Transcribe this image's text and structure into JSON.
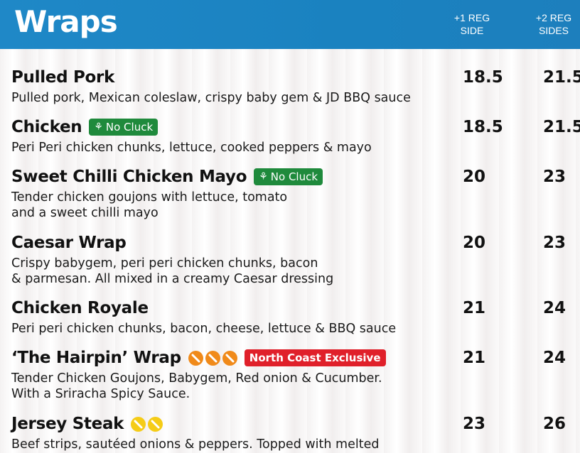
{
  "header": {
    "title": "Wraps",
    "col1": [
      "+1 REG",
      "SIDE"
    ],
    "col2": [
      "+2 REG",
      "SIDES"
    ]
  },
  "badges": {
    "no_cluck": "No Cluck",
    "north_coast": "North Coast Exclusive"
  },
  "items": [
    {
      "name": "Pulled Pork",
      "desc": [
        "Pulled pork, Mexican coleslaw, crispy baby gem & JD BBQ sauce"
      ],
      "p1": "18.5",
      "p2": "21.5"
    },
    {
      "name": "Chicken",
      "desc": [
        "Peri Peri chicken chunks, lettuce, cooked peppers & mayo"
      ],
      "p1": "18.5",
      "p2": "21.5"
    },
    {
      "name": "Sweet Chilli Chicken Mayo",
      "desc": [
        "Tender chicken goujons with lettuce, tomato",
        "and a sweet chilli mayo"
      ],
      "p1": "20",
      "p2": "23"
    },
    {
      "name": "Caesar Wrap",
      "desc": [
        "Crispy babygem, peri peri chicken chunks, bacon",
        "& parmesan. All mixed in a creamy Caesar dressing"
      ],
      "p1": "20",
      "p2": "23"
    },
    {
      "name": "Chicken Royale",
      "desc": [
        "Peri peri chicken chunks, bacon, cheese, lettuce & BBQ sauce"
      ],
      "p1": "21",
      "p2": "24"
    },
    {
      "name": "‘The Hairpin’ Wrap",
      "desc": [
        "Tender Chicken Goujons, Babygem, Red onion & Cucumber.",
        "With a Sriracha Spicy Sauce."
      ],
      "p1": "21",
      "p2": "24"
    },
    {
      "name": "Jersey Steak",
      "desc": [
        "Beef strips, sautéed onions & peppers. Topped with melted"
      ],
      "p1": "23",
      "p2": "26"
    }
  ],
  "colors": {
    "header_blue": "#1a82c0",
    "badge_green": "#1f8a3c",
    "badge_red": "#e0202a",
    "chili_orange": "#f08a1a",
    "chili_yellow": "#f5cc16"
  }
}
